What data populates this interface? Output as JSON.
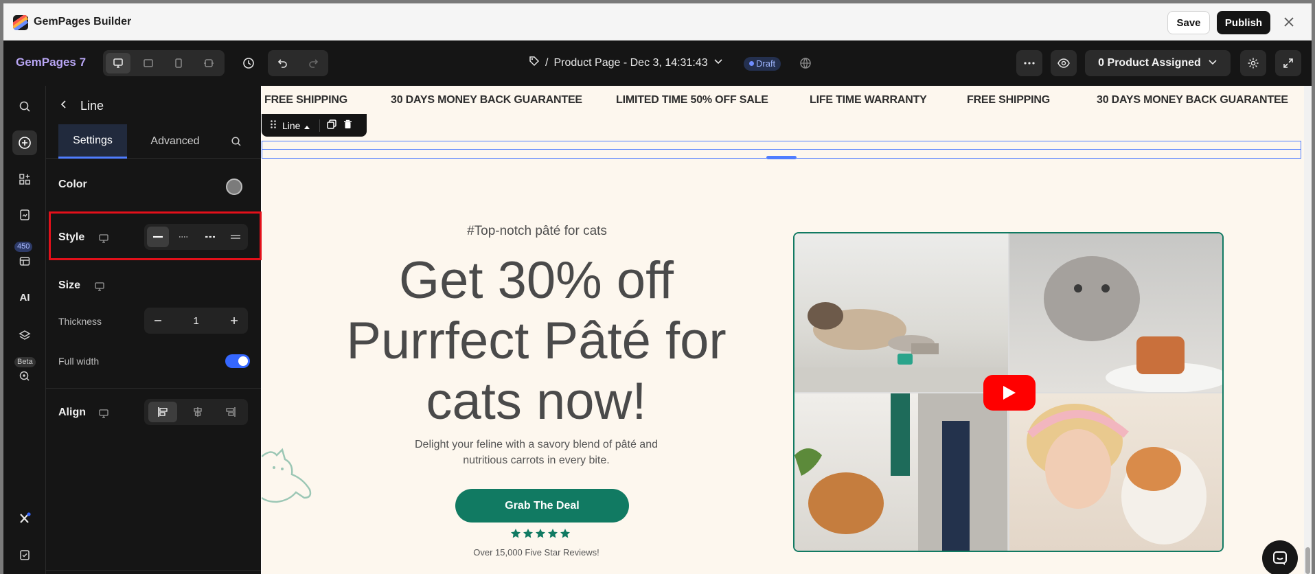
{
  "titlebar": {
    "app_title": "GemPages Builder",
    "save_label": "Save",
    "publish_label": "Publish",
    "close_icon": "close-icon"
  },
  "toolbar": {
    "brand": "GemPages 7",
    "page_prefix": "/",
    "page_name": "Product Page - Dec 3, 14:31:43",
    "status_badge": "Draft",
    "assign_label": "0 Product Assigned"
  },
  "rail": {
    "templates_badge": "450",
    "ai_label": "AI",
    "beta_badge": "Beta"
  },
  "panel": {
    "title": "Line",
    "tabs": [
      {
        "label": "Settings",
        "active": true
      },
      {
        "label": "Advanced",
        "active": false
      }
    ],
    "color_label": "Color",
    "color_value": "#7b7b7b",
    "style_label": "Style",
    "style_options": [
      "solid",
      "dotted",
      "dashed",
      "double"
    ],
    "style_selected": "solid",
    "size_label": "Size",
    "thickness_label": "Thickness",
    "thickness_value": "1",
    "full_width_label": "Full width",
    "full_width_on": true,
    "align_label": "Align",
    "align_options": [
      "left",
      "center",
      "right"
    ],
    "align_selected": "left"
  },
  "canvas": {
    "marquee": [
      "FREE SHIPPING",
      "30 DAYS MONEY BACK GUARANTEE",
      "LIMITED TIME 50% OFF SALE",
      "LIFE TIME WARRANTY",
      "FREE SHIPPING",
      "30 DAYS MONEY BACK GUARANTEE"
    ],
    "selected_element_tag": "Line",
    "hero": {
      "kicker": "#Top-notch pâté for cats",
      "headline_lines": [
        "Get 30% off",
        "Purrfect Pâté for",
        "cats now!"
      ],
      "description": "Delight your feline with a savory blend of pâté and nutritious carrots in every bite.",
      "cta_label": "Grab The Deal",
      "rating_stars": 5,
      "reviews_text": "Over 15,000 Five Star Reviews!"
    }
  },
  "colors": {
    "accent": "#117a62",
    "selection": "#4f7dff",
    "annotation": "#e3101a",
    "canvas_bg": "#fdf7ee"
  }
}
